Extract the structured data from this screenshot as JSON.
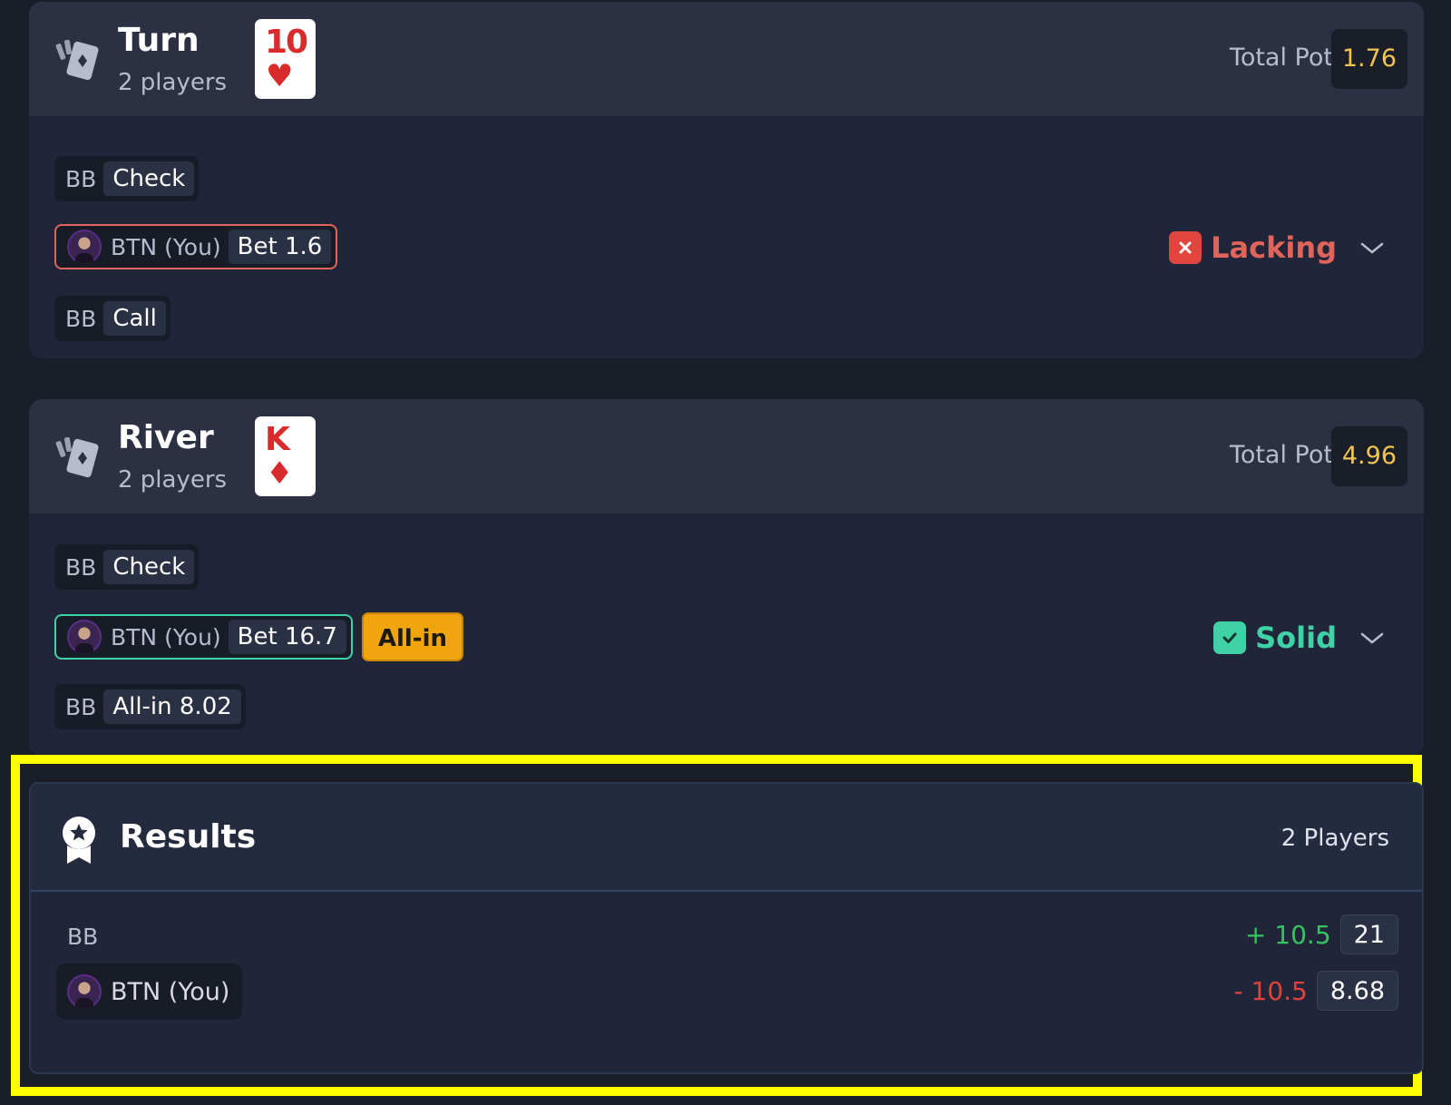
{
  "streets": [
    {
      "name": "Turn",
      "players": "2 players",
      "card": {
        "rank": "10",
        "suit": "♥"
      },
      "pot_label": "Total Pot",
      "pot_value": "1.76",
      "actions": [
        {
          "pos": "BB",
          "action": "Check"
        },
        {
          "pos": "BTN (You)",
          "action": "Bet 1.6"
        },
        {
          "pos": "BB",
          "action": "Call"
        }
      ],
      "verdict": {
        "label": "Lacking",
        "icon": "close-icon",
        "color": "#e0645a"
      }
    },
    {
      "name": "River",
      "players": "2 players",
      "card": {
        "rank": "K",
        "suit": "♦"
      },
      "pot_label": "Total Pot",
      "pot_value": "4.96",
      "actions": [
        {
          "pos": "BB",
          "action": "Check"
        },
        {
          "pos": "BTN (You)",
          "action": "Bet 16.7",
          "tag": "All-in"
        },
        {
          "pos": "BB",
          "action": "All-in 8.02"
        }
      ],
      "verdict": {
        "label": "Solid",
        "icon": "check-icon",
        "color": "#3fd2a6"
      }
    }
  ],
  "results": {
    "title": "Results",
    "count": "2 Players",
    "rows": [
      {
        "pos": "BB",
        "delta": "+ 10.5",
        "stack": "21"
      },
      {
        "pos": "BTN (You)",
        "delta": "- 10.5",
        "stack": "8.68"
      }
    ]
  },
  "colors": {
    "highlight": "#ffff00",
    "pot_value": "#f3c452",
    "all_in_tag": "#f0a50e",
    "positive": "#36c35f",
    "negative": "#e2423c"
  }
}
